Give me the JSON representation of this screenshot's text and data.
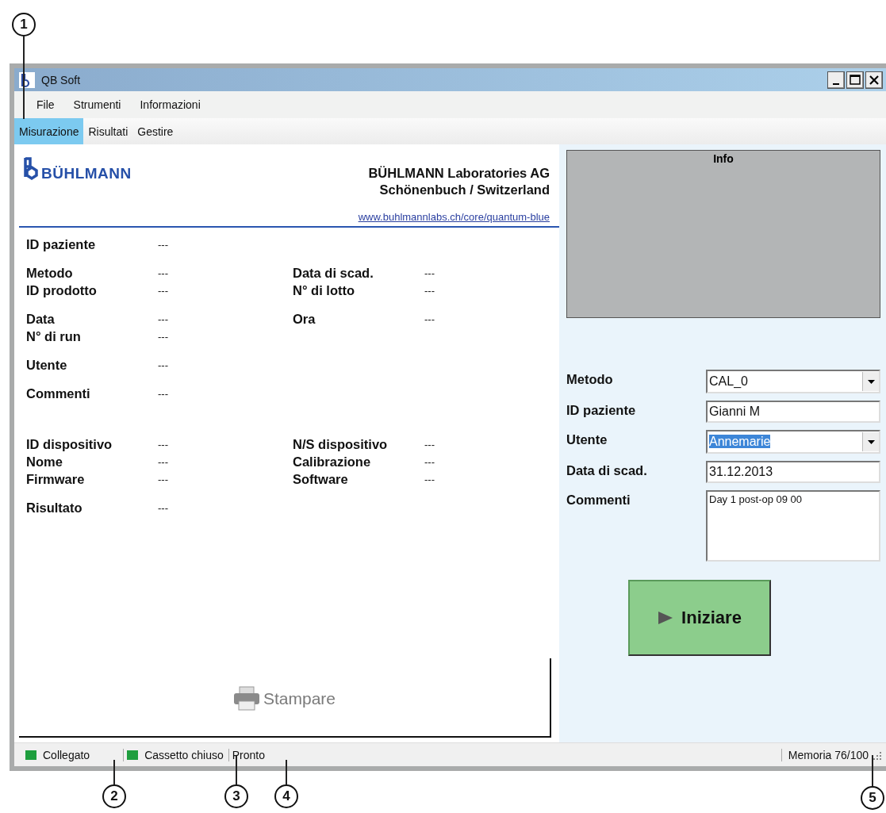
{
  "window": {
    "title": "QB Soft"
  },
  "menu": [
    "File",
    "Strumenti",
    "Informazioni"
  ],
  "tabs": [
    {
      "label": "Misurazione",
      "selected": true
    },
    {
      "label": "Risultati",
      "selected": false
    },
    {
      "label": "Gestire",
      "selected": false
    }
  ],
  "report": {
    "logo": "BÜHLMANN",
    "company": "BÜHLMANN Laboratories AG",
    "location": "Schönenbuch / Switzerland",
    "link": "www.buhlmannlabs.ch/core/quantum-blue",
    "sections": [
      [
        [
          {
            "label": "ID paziente",
            "value": "---"
          }
        ]
      ],
      [
        [
          {
            "label": "Metodo",
            "value": "---"
          },
          {
            "label": "Data di scad.",
            "value": "---"
          }
        ],
        [
          {
            "label": "ID prodotto",
            "value": "---"
          },
          {
            "label": "N° di lotto",
            "value": "---"
          }
        ]
      ],
      [
        [
          {
            "label": "Data",
            "value": "---"
          },
          {
            "label": "Ora",
            "value": "---"
          }
        ],
        [
          {
            "label": "N° di run",
            "value": "---"
          }
        ]
      ],
      [
        [
          {
            "label": "Utente",
            "value": "---"
          }
        ]
      ],
      [
        [
          {
            "label": "Commenti",
            "value": "---"
          }
        ]
      ],
      [
        [
          {
            "label": "ID dispositivo",
            "value": "---"
          },
          {
            "label": "N/S dispositivo",
            "value": "---"
          }
        ],
        [
          {
            "label": "Nome",
            "value": "---"
          },
          {
            "label": "Calibrazione",
            "value": "---"
          }
        ],
        [
          {
            "label": "Firmware",
            "value": "---"
          },
          {
            "label": "Software",
            "value": "---"
          }
        ]
      ],
      [
        [
          {
            "label": "Risultato",
            "value": "---"
          }
        ]
      ]
    ],
    "print_button": {
      "label": "Stampare",
      "disabled": true
    }
  },
  "info": {
    "title": "Info"
  },
  "form": [
    {
      "kind": "dropdown",
      "label": "Metodo",
      "value": "CAL_0",
      "highlighted": false
    },
    {
      "kind": "text",
      "label": "ID paziente",
      "value": "Gianni M",
      "highlighted": false
    },
    {
      "kind": "dropdown",
      "label": "Utente",
      "value": "Annemarie",
      "highlighted": true
    },
    {
      "kind": "text",
      "label": "Data di scad.",
      "value": "31.12.2013",
      "highlighted": false
    },
    {
      "kind": "textarea",
      "label": "Commenti",
      "value": "Day 1 post-op 09 00",
      "highlighted": false
    }
  ],
  "start_button": {
    "label": "Iniziare"
  },
  "status_bar": {
    "items": [
      {
        "kind": "indicator",
        "label": "Collegato",
        "color": "#1e9e3e"
      },
      {
        "kind": "indicator",
        "label": "Cassetto chiuso",
        "color": "#1e9e3e"
      },
      {
        "kind": "text",
        "label": "Pronto"
      }
    ],
    "memory": "Memoria 76/100"
  },
  "callouts": [
    "1",
    "2",
    "3",
    "4",
    "5"
  ]
}
